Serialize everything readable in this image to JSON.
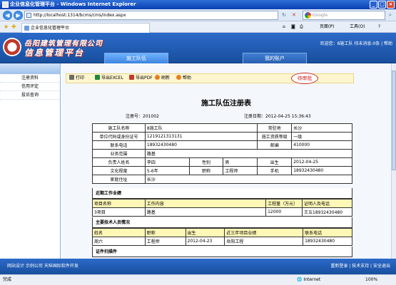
{
  "window": {
    "title": "企业信息化管理平台 - Windows Internet Explorer"
  },
  "browser": {
    "url": "http://localhost:1314/bcms/cms/index.aspx",
    "search_placeholder": "Google",
    "tab_label": "企业信息化管理平台",
    "tools": {
      "page": "页面(P)",
      "tools": "工具(O)"
    }
  },
  "app": {
    "logo_top": "岳阳建筑管理有限公司",
    "logo_bottom": "信息管理平台",
    "nav_active": "施工队伍",
    "nav_second": "我的账户",
    "welcome": "欢迎您：8施工队  待未消息:0条  |  帮助"
  },
  "sidebar": {
    "items": [
      {
        "label": "注册资料"
      },
      {
        "label": "信用评定"
      },
      {
        "label": "投诉查询"
      }
    ]
  },
  "toolbar": {
    "print": "打印",
    "export_excel": "导出EXCEL",
    "export_pdf": "导出PDF",
    "refresh": "刷新",
    "help": "帮助",
    "status": "待审批"
  },
  "doc": {
    "title": "施工队伍注册表",
    "reg_no_label": "注册号：",
    "reg_no": "201002",
    "reg_date_label": "注册日期：",
    "reg_date": "2012-04-25 15:36:43",
    "fields": {
      "team_name_label": "施工队名称",
      "team_name": "8施工队",
      "residence_label": "常驻地",
      "residence": "长沙",
      "org_code_label": "单位代码或身份证号",
      "org_code": "1219121313131",
      "qualification_label": "施工资质等级",
      "qualification": "一级",
      "phone_label": "联系电话",
      "phone": "18932430480",
      "postcode_label": "邮编",
      "postcode": "410000",
      "scope_label": "业务范围",
      "scope": "路基",
      "leader_label": "负责人姓名",
      "leader": "李四",
      "gender_label": "性别",
      "gender": "男",
      "birth_label": "出生",
      "birth": "2012-04-25",
      "education_label": "文化程度",
      "education": "5-6年",
      "title_label": "职称",
      "title": "工程师",
      "mobile_label": "手机",
      "mobile": "18932430480",
      "address_label": "家庭住址",
      "address": "长沙"
    },
    "section_projects": "近期工作业绩",
    "projects": {
      "headers": [
        "项目名称",
        "工作内容",
        "工程量（万元）",
        "证明人及电话"
      ],
      "rows": [
        [
          "3项目",
          "路基",
          "12000",
          "王五18932430480"
        ]
      ]
    },
    "section_staff": "主要技术人员情况",
    "staff": {
      "headers": [
        "姓名",
        "职称",
        "出生",
        "近三年项目业绩",
        "联系电话"
      ],
      "rows": [
        [
          "周六",
          "工程师",
          "2012-04-23",
          "岳阳工程",
          "18932430480"
        ]
      ]
    },
    "section_certs": "证件扫描件"
  },
  "footer": {
    "left": "网站设计 示例公司  天纵国际软件开发",
    "right": "重新登录 | 技术支持 | 安全退出"
  },
  "status": {
    "left": "完成",
    "zone": "Internet",
    "zoom": "100%"
  }
}
